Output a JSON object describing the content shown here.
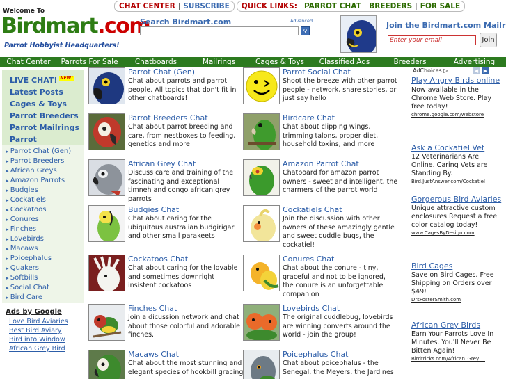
{
  "header": {
    "welcome": "Welcome To",
    "logo_main": "Birdmart",
    "logo_ext": ".com",
    "tagline": "Parrot Hobbyist Headquarters!",
    "top_links": {
      "chat_center": "CHAT CENTER",
      "subscribe": "SUBSCRIBE",
      "quick_links": "QUICK LINKS:",
      "parrot_chat": "PARROT CHAT",
      "breeders": "BREEDERS",
      "for_sale": "FOR SALE",
      "separator": "|"
    },
    "search": {
      "label": "Search Birdmart.com",
      "advanced": "Advanced",
      "button_icon": "search-icon"
    },
    "mailing": {
      "title": "Join the Birdmart.com Mailring",
      "placeholder": "Enter your email",
      "join_label": "Join"
    }
  },
  "nav": [
    "Chat Center",
    "Parrots For Sale",
    "Chatboards",
    "Mailrings",
    "Cages & Toys",
    "Classified Ads",
    "Breeders",
    "Advertising"
  ],
  "sidebar": {
    "strong_items": [
      "LIVE CHAT!",
      "Latest Posts",
      "Cages & Toys",
      "Parrot Breeders",
      "Parrot Mailrings",
      "Parrot Chatboards"
    ],
    "new_badge": "NEW!",
    "links": [
      "Parrot Chat (Gen)",
      "Parrot Breeders",
      "African Greys",
      "Amazon Parrots",
      "Budgies",
      "Cockatiels",
      "Cockatoos",
      "Conures",
      "Finches",
      "Lovebirds",
      "Macaws",
      "Poicephalus",
      "Quakers",
      "Softbills",
      "Social Chat",
      "Bird Care"
    ],
    "ads_title": "Ads by Google",
    "ad_links": [
      "Love Bird Aviaries",
      "Best Bird Aviary",
      "Bird into Window",
      "African Grey Bird"
    ]
  },
  "chats": [
    {
      "title": "Parrot Chat (Gen)",
      "desc": "Chat about parrots and parrot people. All topics that don't fit in other chatboards!",
      "icon": "blue-parrot"
    },
    {
      "title": "Parrot Social Chat",
      "desc": "Shoot the breeze with other parrot people - network, share stories, or just say hello",
      "icon": "smiley"
    },
    {
      "title": "Parrot Breeders Chat",
      "desc": "Chat about parrot breeding and care, from nestboxes to feeding, genetics and more",
      "icon": "macaw-head"
    },
    {
      "title": "Birdcare Chat",
      "desc": "Chat about clipping wings, trimming talons, proper diet, household toxins, and more",
      "icon": "green-parrot"
    },
    {
      "title": "African Grey Chat",
      "desc": "Discuss care and training of the fascinating and exceptional timneh and congo african grey parrots",
      "icon": "grey-parrot"
    },
    {
      "title": "Amazon Parrot Chat",
      "desc": "Chatboard for amazon parrot owners - sweet and intelligent, the charmers of the parrot world",
      "icon": "amazon-parrot"
    },
    {
      "title": "Budgies Chat",
      "desc": "Chat about caring for the ubiquitous australian budgirigar and other small parakeets",
      "icon": "budgie"
    },
    {
      "title": "Cockatiels Chat",
      "desc": "Join the discussion with other owners of these amazingly gentle and sweet cuddle bugs, the cockatiel!",
      "icon": "cockatiel"
    },
    {
      "title": "Cockatoos Chat",
      "desc": "Chat about caring for the lovable and sometimes downright insistent cockatoos",
      "icon": "cockatoo"
    },
    {
      "title": "Conures Chat",
      "desc": "Chat about the conure - tiny, graceful and not to be ignored, the conure is an unforgettable companion",
      "icon": "conure"
    },
    {
      "title": "Finches Chat",
      "desc": "Join a dicussion network and chat about those colorful and adorable finches.",
      "icon": "finch"
    },
    {
      "title": "Lovebirds Chat",
      "desc": "The original cuddlebug, lovebirds are winning converts around the world - join the group!",
      "icon": "lovebirds"
    },
    {
      "title": "Macaws Chat",
      "desc": "Chat about the most stunning and elegant species of hookbill gracing",
      "icon": "macaw"
    },
    {
      "title": "Poicephalus Chat",
      "desc": "Chat about poicephalus - the Senegal, the Meyers, the Jardines",
      "icon": "poicephalus"
    }
  ],
  "right_ads": {
    "adchoices": "AdChoices",
    "items": [
      {
        "title": "Play Angry Birds online",
        "body": "Now available in the Chrome Web Store. Play free today!",
        "url": "chrome.google.com/webstore"
      },
      {
        "title": "Ask a Cockatiel Vet",
        "body": "12 Veterinarians Are Online. Caring Vets are Standing By.",
        "url": "Bird.JustAnswer.com/Cockatiel"
      },
      {
        "title": "Gorgerous Bird Aviaries",
        "body": "Unique attractive custom enclosures Request a free color catalog today!",
        "url": "www.CagesByDesign.com"
      },
      {
        "title": "Bird Cages",
        "body": "Save on Bird Cages. Free Shipping on Orders over $49!",
        "url": "DrsFosterSmith.com"
      },
      {
        "title": "African Grey Birds",
        "body": "Earn Your Parrots Love In Minutes. You'll Never Be Bitten Again!",
        "url": "Birdtricks.com/African_Grey ..."
      }
    ]
  }
}
